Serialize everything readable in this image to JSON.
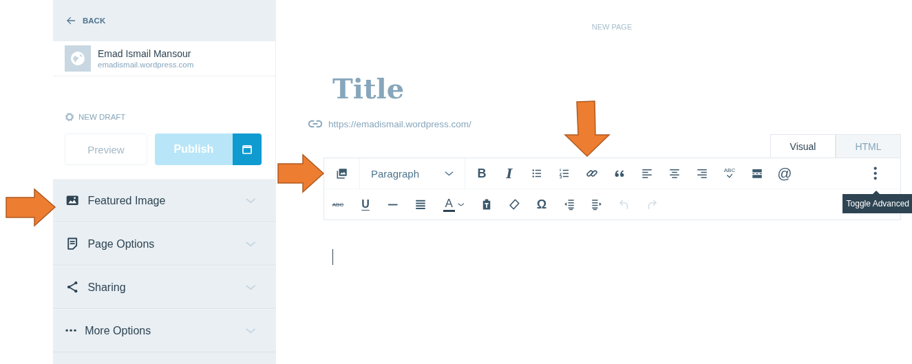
{
  "sidebar": {
    "back": "BACK",
    "site": {
      "name": "Emad Ismail Mansour",
      "domain": "emadismail.wordpress.com"
    },
    "status": "NEW DRAFT",
    "preview": {
      "label": "Preview",
      "disabled": true
    },
    "publish": {
      "label": "Publish",
      "disabled": true
    },
    "sections": [
      {
        "kind": "image",
        "label": "Featured Image",
        "expanded": false
      },
      {
        "kind": "page",
        "label": "Page Options",
        "expanded": false
      },
      {
        "kind": "share",
        "label": "Sharing",
        "expanded": false
      },
      {
        "kind": "ellipsis",
        "label": "More Options",
        "expanded": false
      }
    ]
  },
  "editor": {
    "heading": "NEW PAGE",
    "title": {
      "placeholder": "Title"
    },
    "url": "https://emadismail.wordpress.com/",
    "tabs": [
      {
        "label": "Visual",
        "selected": true
      },
      {
        "label": "HTML",
        "selected": false
      }
    ],
    "toolbar_rows": [
      [
        {
          "kind": "add-media",
          "disabled": false
        },
        {
          "kind": "format-select",
          "value": "Paragraph",
          "disabled": false
        },
        {
          "kind": "bold",
          "glyph": "B",
          "disabled": false
        },
        {
          "kind": "italic",
          "glyph": "I",
          "disabled": false
        },
        {
          "kind": "bullet-list",
          "disabled": false
        },
        {
          "kind": "numbered-list",
          "disabled": false
        },
        {
          "kind": "link",
          "disabled": false
        },
        {
          "kind": "quote",
          "disabled": false
        },
        {
          "kind": "align-left",
          "disabled": false
        },
        {
          "kind": "align-center",
          "disabled": false
        },
        {
          "kind": "align-right",
          "disabled": false
        },
        {
          "kind": "spellcheck",
          "glyph": "ABC",
          "disabled": false
        },
        {
          "kind": "read-more",
          "disabled": false
        },
        {
          "kind": "mention",
          "glyph": "@",
          "disabled": false
        },
        {
          "kind": "kebab",
          "disabled": false
        }
      ],
      [
        {
          "kind": "strikethrough",
          "glyph": "ABC",
          "disabled": false
        },
        {
          "kind": "underline",
          "glyph": "U",
          "disabled": false
        },
        {
          "kind": "hr",
          "disabled": false
        },
        {
          "kind": "justify",
          "disabled": false
        },
        {
          "kind": "text-color",
          "glyph": "A",
          "disabled": false
        },
        {
          "kind": "paste-text",
          "disabled": false
        },
        {
          "kind": "eraser",
          "disabled": false
        },
        {
          "kind": "special-char",
          "glyph": "Ω",
          "disabled": false
        },
        {
          "kind": "outdent",
          "disabled": false
        },
        {
          "kind": "indent",
          "disabled": false
        },
        {
          "kind": "undo",
          "disabled": true
        },
        {
          "kind": "redo",
          "disabled": true
        }
      ]
    ],
    "tooltip": "Toggle Advanced"
  }
}
